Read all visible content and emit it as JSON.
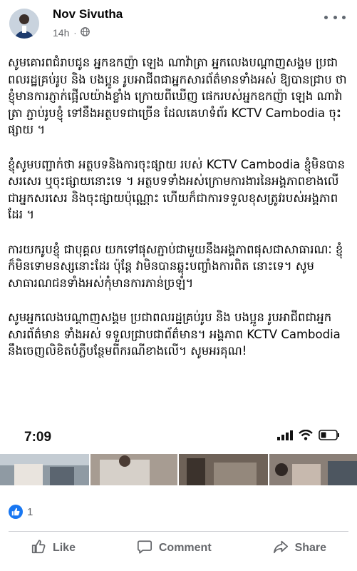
{
  "post": {
    "author": "Nov Sivutha",
    "time": "14h",
    "privacy_icon": "globe-icon",
    "paragraphs": [
      "សូមគោរពជំរាបជូន អ្នកឧកញ៉ា ឡេង ណាវ៉ាត្រា អ្នកលេងបណ្តាញសង្គម ប្រជាពលរដ្ឋគ្រប់រូប និង បងប្អូន រូបអាជីពជាអ្នកសារព័ត៌មានទាំងអស់ ឱ្យបានជ្រាប ថា ខ្ញុំមានការភ្ញាក់ផ្អើលយ៉ាងខ្លាំង ក្រោយពីឃើញ ផេករបស់អ្នកឧកញ៉ា ឡេង ណាវ៉ាត្រា ភ្ជាប់រូបខ្ញុំ ទៅនឹងអត្ថបទជាច្រើន ដែលគេហទំព័រ KCTV Cambodia ចុះផ្សាយ ។",
      "ខ្ញុំសូមបញ្ជាក់ថា អត្ថបទនិងការចុះផ្សាយ របស់ KCTV Cambodia ខ្ញុំមិនបានសរសេរ ឬចុះផ្សាយនោះទេ ។ អត្ថបទទាំងអស់ក្រោមការងារនៃអង្គភាពខាងលើជាអ្នកសរសេរ និងចុះផ្សាយប៉ុណ្ណោះ ហើយក៏ជាការទទួលខុសត្រូវរបស់អង្គភាពដែរ ។",
      "ការយករូបខ្ញុំ ជាបុគ្គល យកទៅផុសភ្ជាប់ជាមួយនឹងអង្គភាពផុសជាសាធារណៈ ខ្ញុំក៏មិនទោមនស្សនោះដែរ ប៉ុន្តែ វាមិនបានឆ្លុះបញ្ចាំងការពិត នោះទេ។ សូមសាធារណជនទាំងអស់កុំមានការភាន់ច្រឡំ។",
      "សូមអ្នកលេងបណ្តាញសង្គម ប្រជាពលរដ្ឋគ្រប់រូប និង បងប្អូន រូបអាជីពជាអ្នកសារព័ត៌មាន ទាំងអស់ ទទួលជ្រាបជាព័ត៌មាន។ អង្គភាព KCTV Cambodia នឹងចេញលិខិតបំភ្លឺបន្ថែមពីករណីខាងលើ។ សូមអរគុណ!"
    ]
  },
  "attachment": {
    "status_time": "7:09"
  },
  "reactions": {
    "count": "1"
  },
  "actions": {
    "like_label": "Like",
    "comment_label": "Comment",
    "share_label": "Share"
  },
  "colors": {
    "accent": "#1877f2",
    "muted_text": "#65676b",
    "divider": "#ced0d4"
  }
}
